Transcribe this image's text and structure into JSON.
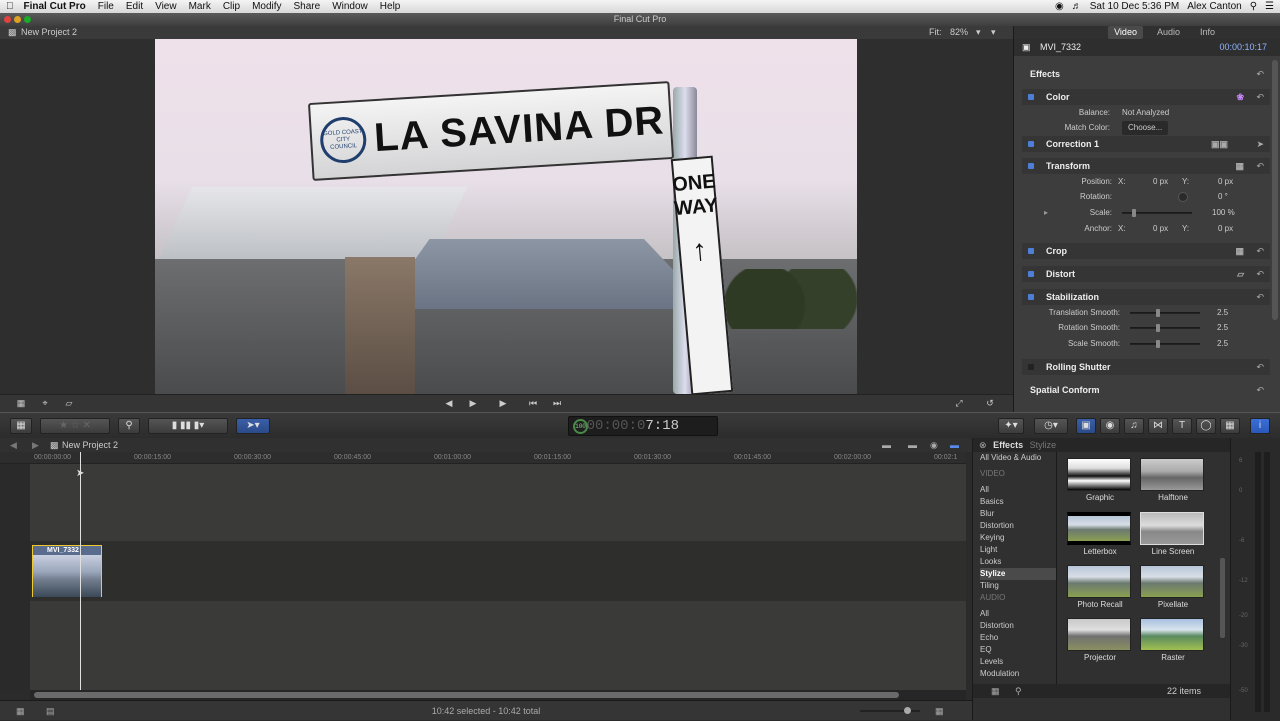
{
  "menubar": {
    "app": "Final Cut Pro",
    "items": [
      "File",
      "Edit",
      "View",
      "Mark",
      "Clip",
      "Modify",
      "Share",
      "Window",
      "Help"
    ],
    "datetime": "Sat 10 Dec  5:36 PM",
    "user": "Alex Canton"
  },
  "window_title": "Final Cut Pro",
  "viewer": {
    "project": "New Project 2",
    "fit_label": "Fit:",
    "fit_value": "82%",
    "sign_text": "LA SAVINA DR",
    "sign_seal": "GOLD COAST CITY COUNCIL",
    "oneway_line1": "ONE",
    "oneway_line2": "WAY"
  },
  "inspector": {
    "tabs": [
      "Video",
      "Audio",
      "Info"
    ],
    "clip_name": "MVI_7332",
    "duration": "00:00:10:17",
    "effects_label": "Effects",
    "color_label": "Color",
    "balance_label": "Balance:",
    "balance_value": "Not Analyzed",
    "match_label": "Match Color:",
    "match_value": "Choose...",
    "correction_label": "Correction 1",
    "transform_label": "Transform",
    "position_label": "Position:",
    "rotation_label": "Rotation:",
    "scale_label": "Scale:",
    "anchor_label": "Anchor:",
    "x_label": "X:",
    "y_label": "Y:",
    "zero_px": "0 px",
    "rotation_value": "0 °",
    "scale_value": "100 %",
    "crop_label": "Crop",
    "distort_label": "Distort",
    "stabilization_label": "Stabilization",
    "trans_smooth_label": "Translation Smooth:",
    "rot_smooth_label": "Rotation Smooth:",
    "scale_smooth_label": "Scale Smooth:",
    "smooth_value": "2.5",
    "rolling_label": "Rolling Shutter",
    "spatial_label": "Spatial Conform"
  },
  "toolbar": {
    "timecode_dim": "00:00:0",
    "timecode_bright": "7:18",
    "timecode_badge": "100"
  },
  "timeline": {
    "project": "New Project 2",
    "ticks": [
      "00:00:00:00",
      "00:00:15:00",
      "00:00:30:00",
      "00:00:45:00",
      "00:01:00:00",
      "00:01:15:00",
      "00:01:30:00",
      "00:01:45:00",
      "00:02:00:00",
      "00:02:1"
    ],
    "clip_name": "MVI_7332",
    "status": "10:42 selected - 10:42 total"
  },
  "browser": {
    "title": "Effects",
    "subtitle": "Stylize",
    "categories": [
      "All Video & Audio",
      "VIDEO",
      "All",
      "Basics",
      "Blur",
      "Distortion",
      "Keying",
      "Light",
      "Looks",
      "Stylize",
      "Tiling",
      "AUDIO",
      "All",
      "Distortion",
      "Echo",
      "EQ",
      "Levels",
      "Modulation"
    ],
    "thumbs": [
      "Graphic",
      "Halftone",
      "Letterbox",
      "Line Screen",
      "Photo Recall",
      "Pixellate",
      "Projector",
      "Raster"
    ],
    "count": "22 items"
  },
  "meter": {
    "labels": [
      "6",
      "0",
      "-6",
      "-12",
      "-20",
      "-30",
      "-50"
    ]
  }
}
